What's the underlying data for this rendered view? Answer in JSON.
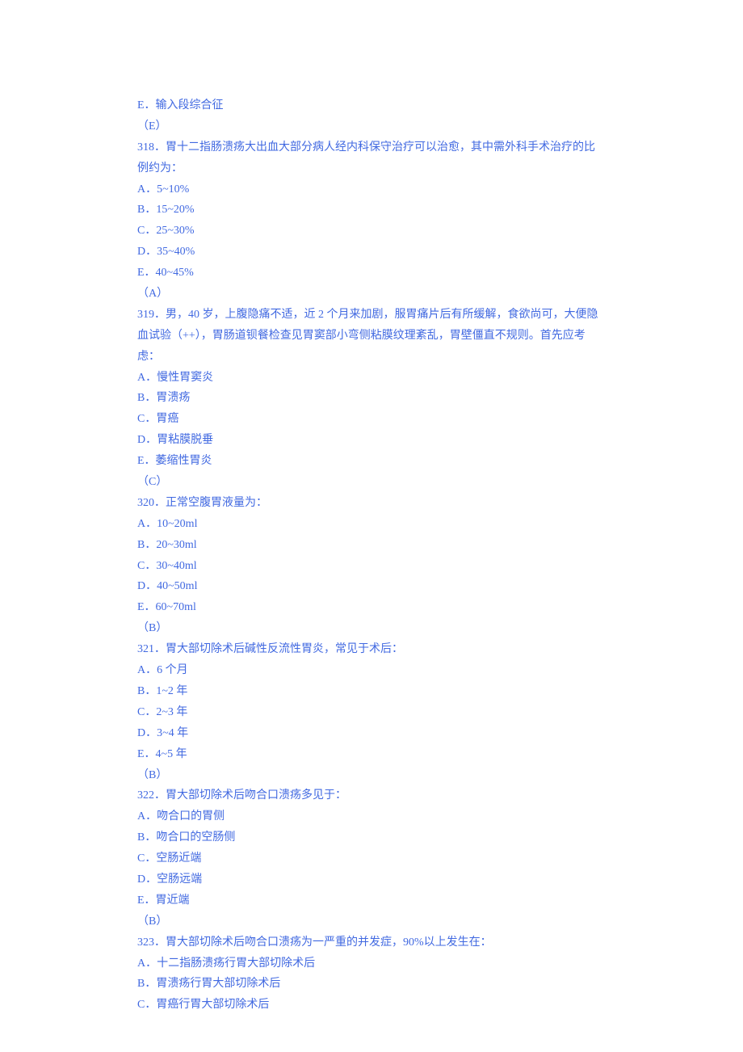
{
  "lines": [
    "E．输入段综合征",
    "（E）",
    "318．胃十二指肠溃疡大出血大部分病人经内科保守治疗可以治愈，其中需外科手术治疗的比例约为：",
    "A．5~10%",
    "B．15~20%",
    "C．25~30%",
    "D．35~40%",
    "E．40~45%",
    "（A）",
    "319．男，40 岁，上腹隐痛不适，近 2 个月来加剧，服胃痛片后有所缓解，食欲尚可，大便隐血试验（++），胃肠道钡餐检查见胃窦部小弯侧粘膜纹理紊乱，胃壁僵直不规则。首先应考虑：",
    "A．慢性胃窦炎",
    "B．胃溃疡",
    "C．胃癌",
    "D．胃粘膜脱垂",
    "E．萎缩性胃炎",
    "（C）",
    "320．正常空腹胃液量为：",
    "A．10~20ml",
    "B．20~30ml",
    "C．30~40ml",
    "D．40~50ml",
    "E．60~70ml",
    "（B）",
    "321．胃大部切除术后碱性反流性胃炎，常见于术后：",
    "A．6 个月",
    "B．1~2 年",
    "C．2~3 年",
    "D．3~4 年",
    "E．4~5 年",
    "（B）",
    "322．胃大部切除术后吻合口溃疡多见于：",
    "A．吻合口的胃侧",
    "B．吻合口的空肠侧",
    "C．空肠近端",
    "D．空肠远端",
    "E．胃近端",
    "（B）",
    "323．胃大部切除术后吻合口溃疡为一严重的并发症，90%以上发生在：",
    "A．十二指肠溃疡行胃大部切除术后",
    "B．胃溃疡行胃大部切除术后",
    "C．胃癌行胃大部切除术后"
  ]
}
